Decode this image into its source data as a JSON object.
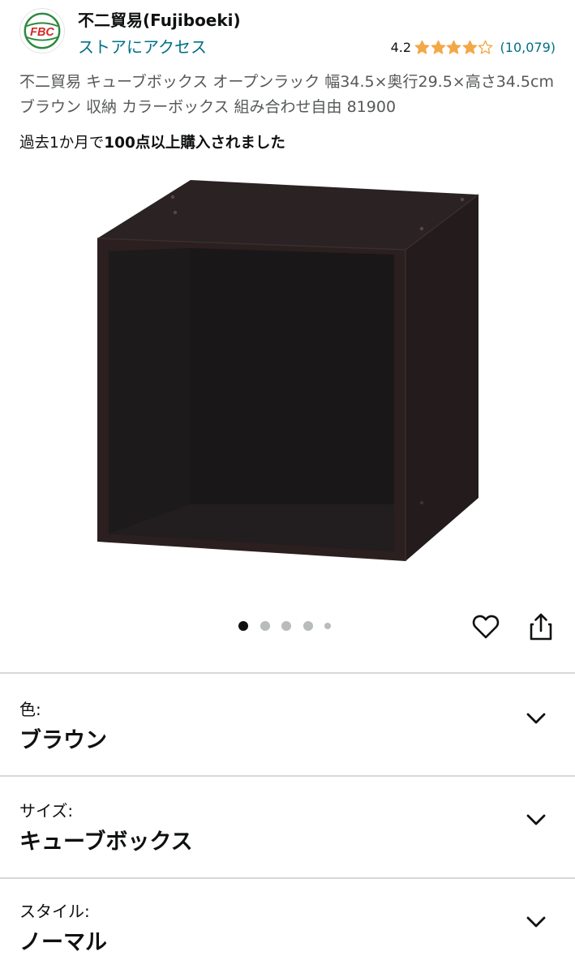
{
  "store": {
    "logo_text": "FBC",
    "name": "不二貿易(Fujiboeki)",
    "link": "ストアにアクセス"
  },
  "rating": {
    "value": "4.2",
    "stars": 4.2,
    "count": "(10,079)"
  },
  "product": {
    "title": "不二貿易 キューブボックス オープンラック 幅34.5×奥行29.5×高さ34.5cm ブラウン 収納 カラーボックス 組み合わせ自由 81900",
    "bought_prefix": "過去1か月で",
    "bought_emphasis": "100点以上購入されました"
  },
  "gallery": {
    "image_icon": "cube-box-photo",
    "total_dots": 5,
    "active_index": 0
  },
  "actions": {
    "wishlist_icon": "heart-icon",
    "share_icon": "share-icon"
  },
  "variants": [
    {
      "label": "色:",
      "value": "ブラウン"
    },
    {
      "label": "サイズ:",
      "value": "キューブボックス"
    },
    {
      "label": "スタイル:",
      "value": "ノーマル"
    }
  ],
  "colors": {
    "link": "#007185",
    "star": "#f3a847",
    "text": "#0f1111",
    "muted": "#565959",
    "box": "#1f1718"
  }
}
